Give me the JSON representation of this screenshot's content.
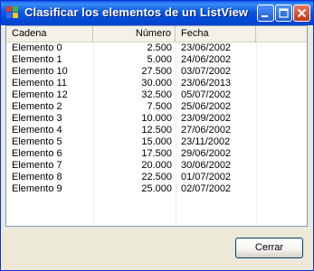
{
  "window": {
    "title": "Clasificar los elementos de un ListView",
    "accent": "#0054e3"
  },
  "title_buttons": [
    "minimize-icon",
    "maximize-icon",
    "close-icon"
  ],
  "listview": {
    "columns": [
      "Cadena",
      "Número",
      "Fecha"
    ],
    "rows": [
      [
        "Elemento 0",
        "2.500",
        "23/06/2002"
      ],
      [
        "Elemento 1",
        "5.000",
        "24/06/2002"
      ],
      [
        "Elemento 10",
        "27.500",
        "03/07/2002"
      ],
      [
        "Elemento 11",
        "30.000",
        "23/06/2013"
      ],
      [
        "Elemento 12",
        "32.500",
        "05/07/2002"
      ],
      [
        "Elemento 2",
        "7.500",
        "25/06/2002"
      ],
      [
        "Elemento 3",
        "10.000",
        "23/09/2002"
      ],
      [
        "Elemento 4",
        "12.500",
        "27/06/2002"
      ],
      [
        "Elemento 5",
        "15.000",
        "23/11/2002"
      ],
      [
        "Elemento 6",
        "17.500",
        "29/06/2002"
      ],
      [
        "Elemento 7",
        "20.000",
        "30/06/2002"
      ],
      [
        "Elemento 8",
        "22.500",
        "01/07/2002"
      ],
      [
        "Elemento 9",
        "25.000",
        "02/07/2002"
      ]
    ]
  },
  "footer": {
    "close_label": "Cerrar"
  }
}
